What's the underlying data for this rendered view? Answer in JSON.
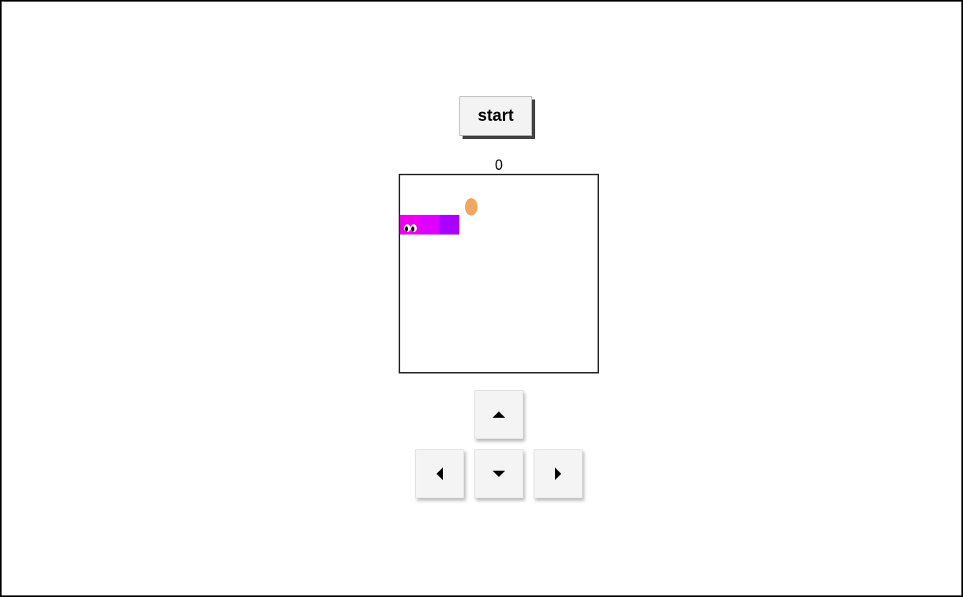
{
  "game": {
    "start_label": "start",
    "score": "0"
  },
  "board": {
    "colors": {
      "snake_head": "#ee00ee",
      "snake_mid": "#dd00ff",
      "snake_tail": "#aa00ff",
      "food": "#f0a860",
      "eye_white": "#ffffff",
      "pupil": "#111111"
    }
  },
  "controls": {
    "up_icon": "triangle-up",
    "down_icon": "triangle-down",
    "left_icon": "triangle-left",
    "right_icon": "triangle-right"
  }
}
